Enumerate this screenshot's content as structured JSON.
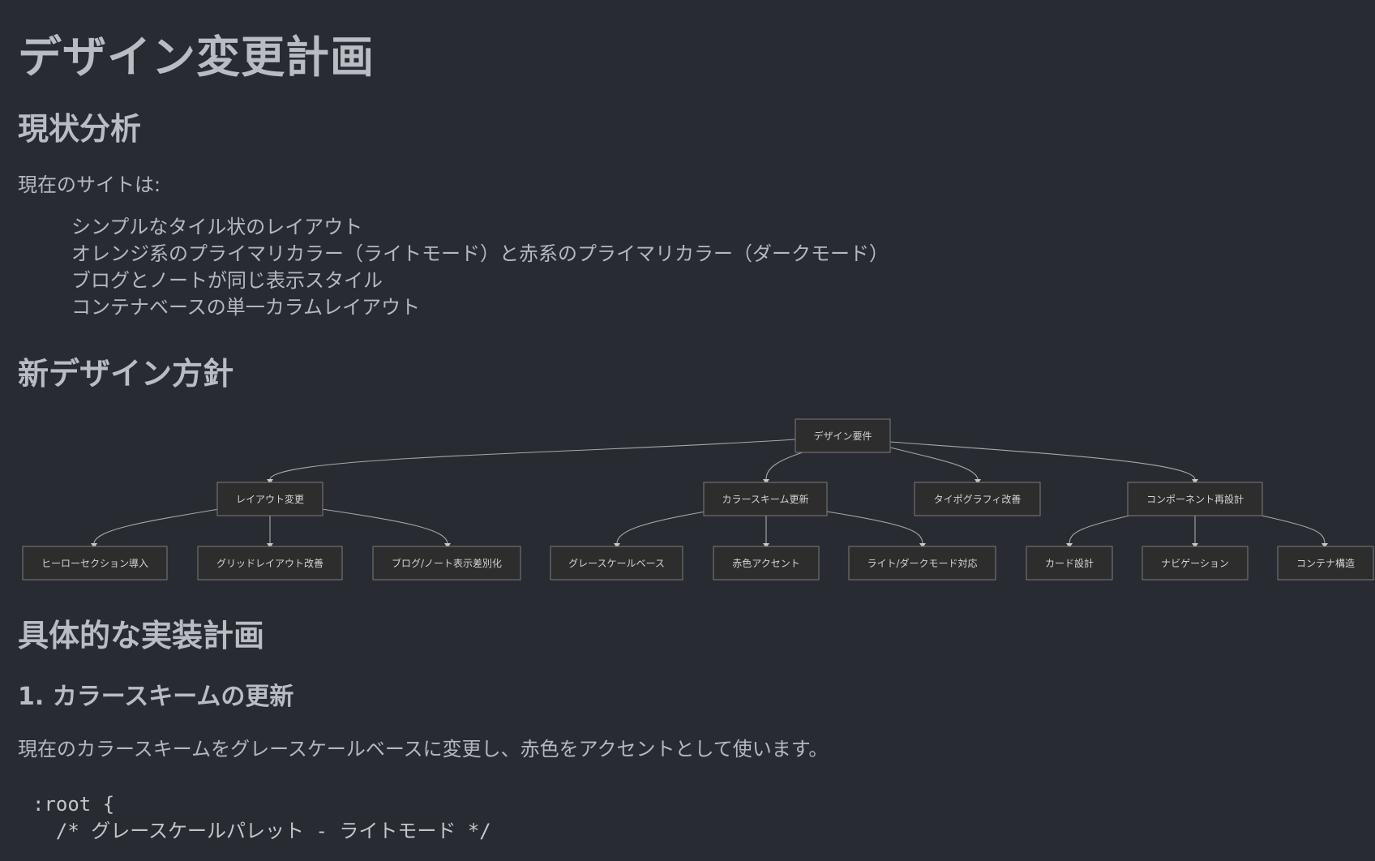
{
  "title": "デザイン変更計画",
  "sections": {
    "analysis": {
      "heading": "現状分析",
      "intro": "現在のサイトは:",
      "items": [
        "シンプルなタイル状のレイアウト",
        "オレンジ系のプライマリカラー（ライトモード）と赤系のプライマリカラー（ダークモード）",
        "ブログとノートが同じ表示スタイル",
        "コンテナベースの単一カラムレイアウト"
      ]
    },
    "policy": {
      "heading": "新デザイン方針",
      "diagram": {
        "root": "デザイン要件",
        "branches": [
          "レイアウト変更",
          "カラースキーム更新",
          "タイポグラフィ改善",
          "コンポーネント再設計"
        ],
        "leaves": [
          "ヒーローセクション導入",
          "グリッドレイアウト改善",
          "ブログ/ノート表示差別化",
          "グレースケールベース",
          "赤色アクセント",
          "ライト/ダークモード対応",
          "カード設計",
          "ナビゲーション",
          "コンテナ構造"
        ]
      }
    },
    "plan": {
      "heading": "具体的な実装計画",
      "sub1": {
        "heading": "1. カラースキームの更新",
        "text": "現在のカラースキームをグレースケールベースに変更し、赤色をアクセントとして使います。",
        "code": [
          ":root {",
          "  /* グレースケールパレット - ライトモード */"
        ]
      }
    }
  },
  "colors": {
    "background": "#282b32",
    "heading": "#b9bcc2",
    "node_fill": "#2d2d2d",
    "node_stroke": "#6f6f6f"
  }
}
